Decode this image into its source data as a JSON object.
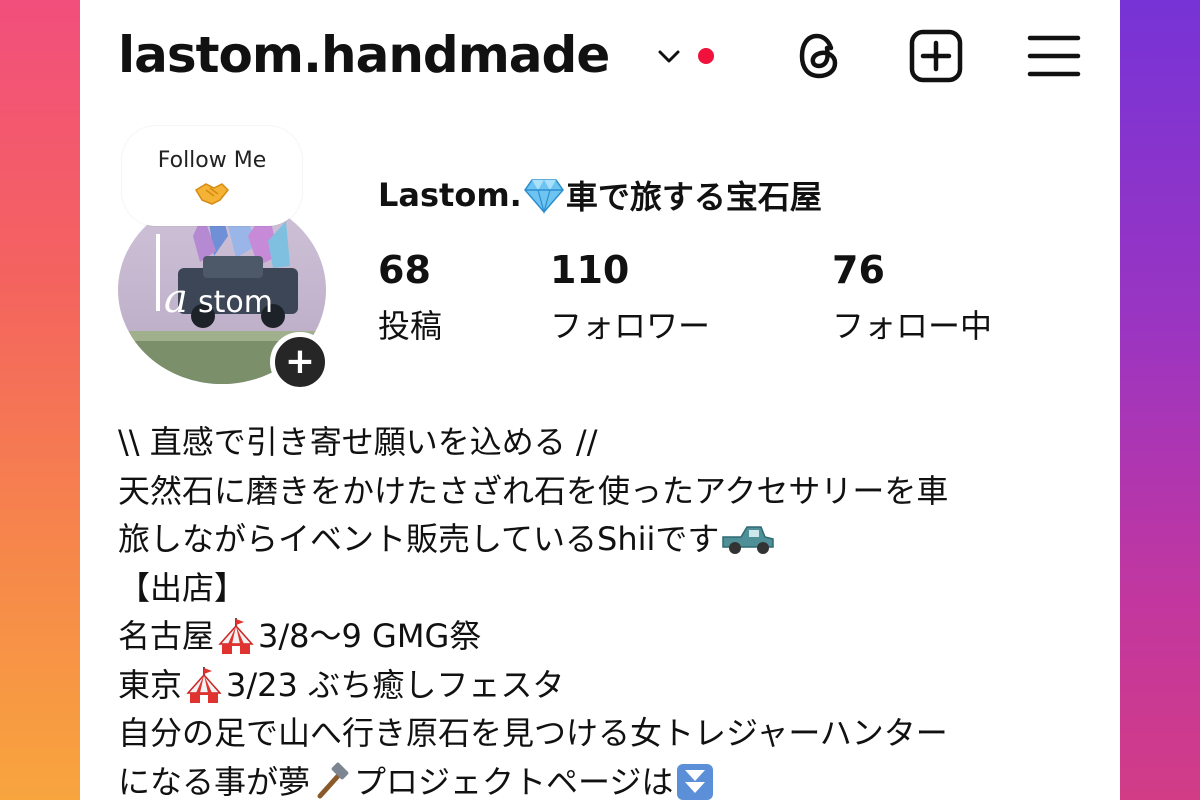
{
  "header": {
    "username": "lastom.handmade",
    "icons": [
      "chevron-down-icon",
      "threads-icon",
      "new-post-icon",
      "menu-icon"
    ],
    "notification_dot_color": "#f0123b"
  },
  "profile": {
    "follow_bubble_text": "Follow Me",
    "avatar_text": "lastom",
    "display_name_part1": "Lastom.",
    "display_name_part2": "車で旅する宝石屋",
    "stats": {
      "posts": {
        "count": "68",
        "label": "投稿"
      },
      "followers": {
        "count": "110",
        "label": "フォロワー"
      },
      "following": {
        "count": "76",
        "label": "フォロー中"
      }
    }
  },
  "bio": {
    "line1": "\\\\ 直感で引き寄せ願いを込める //",
    "line2": "天然石に磨きをかけたさざれ石を使ったアクセサリーを車",
    "line3": "旅しながらイベント販売しているShiiです",
    "line4": "【出店】",
    "line5a": "名古屋",
    "line5b": "3/8～9 GMG祭",
    "line6a": "東京",
    "line6b": "3/23 ぶち癒しフェスタ",
    "line7": "自分の足で山へ行き原石を見つける女トレジャーハンター",
    "line8a": "になる事が夢",
    "line8b": "プロジェクトページは"
  },
  "colors": {
    "gradient_left": "#f24f7c",
    "gradient_right": "#7733d6",
    "text": "#111111",
    "add_story_button": "#262626"
  }
}
